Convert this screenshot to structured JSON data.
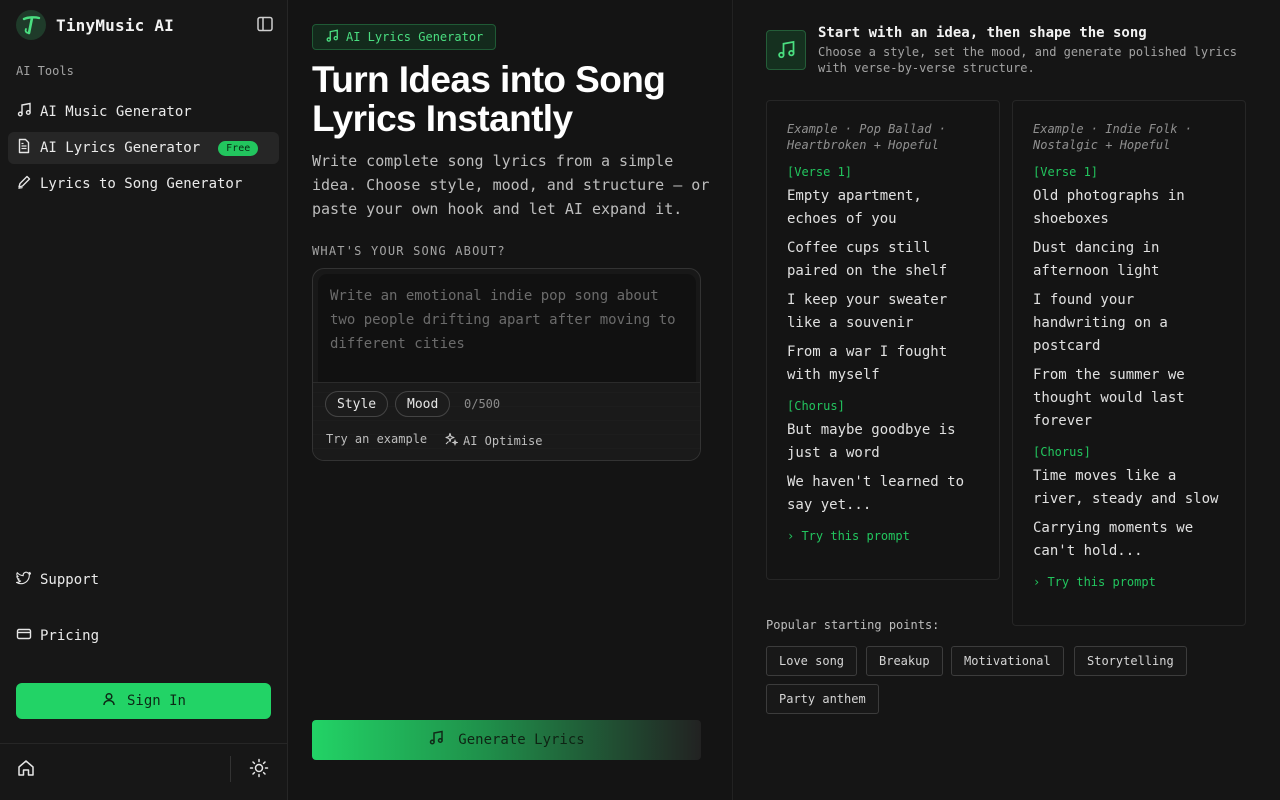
{
  "colors": {
    "accent": "#22c55e",
    "accent_bright": "#22d366",
    "background": "#141414"
  },
  "sidebar": {
    "brand": "TinyMusic AI",
    "section_label": "AI Tools",
    "items": [
      {
        "label": "AI Music Generator",
        "icon": "music-note-icon"
      },
      {
        "label": "AI Lyrics Generator",
        "icon": "document-icon",
        "badge": "Free"
      },
      {
        "label": "Lyrics to Song Generator",
        "icon": "pen-icon"
      }
    ],
    "support": "Support",
    "pricing": "Pricing",
    "sign_in": "Sign In"
  },
  "main": {
    "pill": "AI Lyrics Generator",
    "headline": "Turn Ideas into Song Lyrics Instantly",
    "description": "Write complete song lyrics from a simple idea. Choose style, mood, and structure — or paste your own hook and let AI expand it.",
    "field_label": "WHAT'S YOUR SONG ABOUT?",
    "placeholder": "Write an emotional indie pop song about two people drifting apart after moving to different cities",
    "value": "",
    "chip_style": "Style",
    "chip_mood": "Mood",
    "counter": "0/500",
    "try_example": "Try an example",
    "optimise": "AI Optimise",
    "generate": "Generate Lyrics"
  },
  "right": {
    "tip_title": "Start with an idea, then shape the song",
    "tip_sub": "Choose a style, set the mood, and generate polished lyrics with verse-by-verse structure.",
    "cards": [
      {
        "meta": "Example · Pop Ballad · Heartbroken + Hopeful",
        "verse_label": "[Verse 1]",
        "verse": [
          "Empty apartment, echoes of you",
          "Coffee cups still paired on the shelf",
          "I keep your sweater like a souvenir",
          "From a war I fought with myself"
        ],
        "chorus_label": "[Chorus]",
        "chorus": [
          "But maybe goodbye is just a word",
          "We haven't learned to say yet..."
        ],
        "try": "› Try this prompt"
      },
      {
        "meta": "Example · Indie Folk · Nostalgic + Hopeful",
        "verse_label": "[Verse 1]",
        "verse": [
          "Old photographs in shoeboxes",
          "Dust dancing in afternoon light",
          "I found your handwriting on a postcard",
          "From the summer we thought would last forever"
        ],
        "chorus_label": "[Chorus]",
        "chorus": [
          "Time moves like a river, steady and slow",
          "Carrying moments we can't hold..."
        ],
        "try": "› Try this prompt"
      }
    ],
    "popular_label": "Popular starting points:",
    "tags": [
      "Love song",
      "Breakup",
      "Motivational",
      "Storytelling",
      "Party anthem"
    ]
  }
}
